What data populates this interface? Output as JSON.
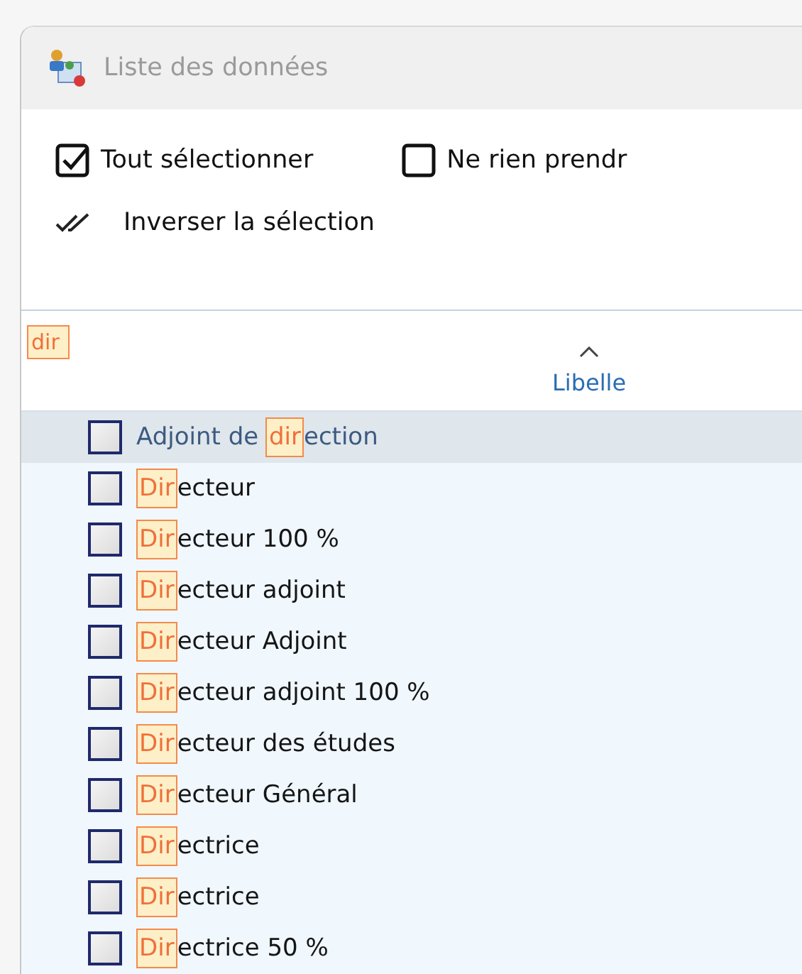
{
  "window": {
    "title": "Liste des données"
  },
  "toolbar": {
    "options": [
      {
        "kind": "checkbox",
        "label": "Tout sélectionner",
        "checked": true
      },
      {
        "kind": "checkbox",
        "label": "Ne rien prendr",
        "checked": false
      }
    ],
    "invert": {
      "label": "Inverser la sélection"
    }
  },
  "table": {
    "filter": {
      "value": "dir"
    },
    "columns": [
      {
        "label": "Libelle",
        "sorted": true
      }
    ],
    "rows": [
      {
        "segments": [
          {
            "text": "Adjoint de ",
            "highlight": false
          },
          {
            "text": "dir",
            "highlight": true
          },
          {
            "text": "ection",
            "highlight": false
          }
        ],
        "checked": false,
        "selected": true
      },
      {
        "segments": [
          {
            "text": "Dir",
            "highlight": true
          },
          {
            "text": "ecteur",
            "highlight": false
          }
        ],
        "checked": false,
        "selected": false
      },
      {
        "segments": [
          {
            "text": "Dir",
            "highlight": true
          },
          {
            "text": "ecteur 100 %",
            "highlight": false
          }
        ],
        "checked": false,
        "selected": false
      },
      {
        "segments": [
          {
            "text": "Dir",
            "highlight": true
          },
          {
            "text": "ecteur adjoint",
            "highlight": false
          }
        ],
        "checked": false,
        "selected": false
      },
      {
        "segments": [
          {
            "text": "Dir",
            "highlight": true
          },
          {
            "text": "ecteur Adjoint",
            "highlight": false
          }
        ],
        "checked": false,
        "selected": false
      },
      {
        "segments": [
          {
            "text": "Dir",
            "highlight": true
          },
          {
            "text": "ecteur adjoint 100 %",
            "highlight": false
          }
        ],
        "checked": false,
        "selected": false
      },
      {
        "segments": [
          {
            "text": "Dir",
            "highlight": true
          },
          {
            "text": "ecteur des études",
            "highlight": false
          }
        ],
        "checked": false,
        "selected": false
      },
      {
        "segments": [
          {
            "text": "Dir",
            "highlight": true
          },
          {
            "text": "ecteur Général",
            "highlight": false
          }
        ],
        "checked": false,
        "selected": false
      },
      {
        "segments": [
          {
            "text": "Dir",
            "highlight": true
          },
          {
            "text": "ectrice",
            "highlight": false
          }
        ],
        "checked": false,
        "selected": false
      },
      {
        "segments": [
          {
            "text": "Dir",
            "highlight": true
          },
          {
            "text": "ectrice",
            "highlight": false
          }
        ],
        "checked": false,
        "selected": false
      },
      {
        "segments": [
          {
            "text": "Dir",
            "highlight": true
          },
          {
            "text": "ectrice 50 %",
            "highlight": false
          }
        ],
        "checked": false,
        "selected": false
      }
    ]
  }
}
